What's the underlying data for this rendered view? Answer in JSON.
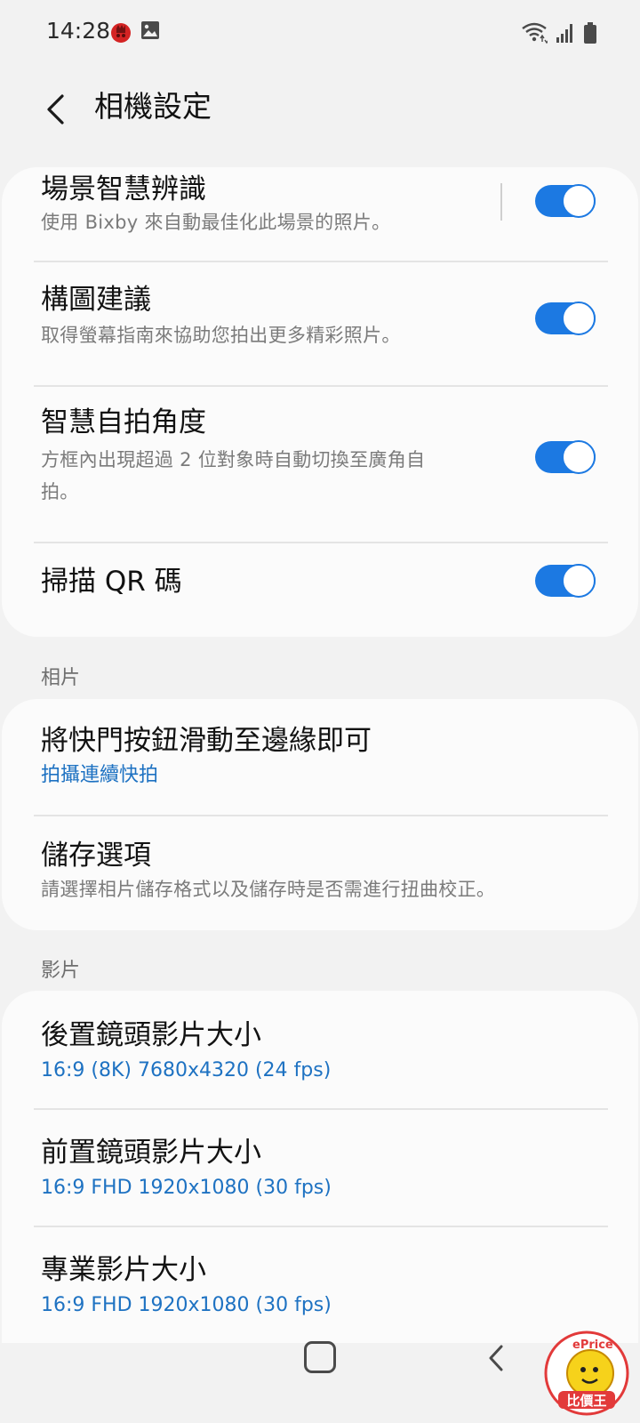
{
  "status_bar": {
    "time": "14:28"
  },
  "header": {
    "title": "相機設定"
  },
  "card1": {
    "items": [
      {
        "title": "場景智慧辨識",
        "subtitle": "使用 Bixby 來自動最佳化此場景的照片。",
        "toggle": true
      },
      {
        "title": "構圖建議",
        "subtitle": "取得螢幕指南來協助您拍出更多精彩照片。",
        "toggle": true
      },
      {
        "title": "智慧自拍角度",
        "subtitle_line1": "方框內出現超過 2 位對象時自動切換至廣角自",
        "subtitle_line2": "拍。",
        "toggle": true
      },
      {
        "title": "掃描 QR 碼",
        "toggle": true
      }
    ]
  },
  "section_photos": {
    "header": "相片",
    "items": [
      {
        "title": "將快門按鈕滑動至邊緣即可",
        "value": "拍攝連續快拍"
      },
      {
        "title": "儲存選項",
        "subtitle": "請選擇相片儲存格式以及儲存時是否需進行扭曲校正。"
      }
    ]
  },
  "section_video": {
    "header": "影片",
    "items": [
      {
        "title": "後置鏡頭影片大小",
        "value": "16:9 (8K) 7680x4320 (24 fps)"
      },
      {
        "title": "前置鏡頭影片大小",
        "value": "16:9 FHD 1920x1080 (30 fps)"
      },
      {
        "title": "專業影片大小",
        "value": "16:9 FHD 1920x1080 (30 fps)"
      }
    ]
  },
  "colors": {
    "accent": "#1c79e2",
    "link_blue": "#1e72c2",
    "background": "#f2f2f2",
    "card": "#fbfbfb"
  },
  "icons": [
    "app-notification-icon",
    "gallery-icon",
    "wifi-icon",
    "signal-icon",
    "battery-icon",
    "back-arrow-icon",
    "home-button",
    "nav-back-icon"
  ]
}
